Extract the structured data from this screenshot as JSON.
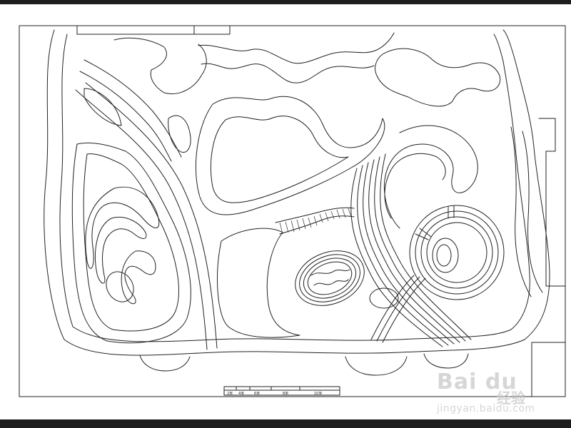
{
  "drawing": {
    "type": "park-master-plan-linework",
    "background": "#ffffff",
    "line_color": "#222222",
    "frame_color": "#1e1e1e"
  },
  "scale_bar": {
    "labels": [
      "2米",
      "4米",
      "6米",
      "8米",
      "10米"
    ]
  },
  "watermark": {
    "logo": "Bai du",
    "brand_cn": "经验",
    "url": "jingyan.baidu.com",
    "color": "#d9d9d9"
  }
}
